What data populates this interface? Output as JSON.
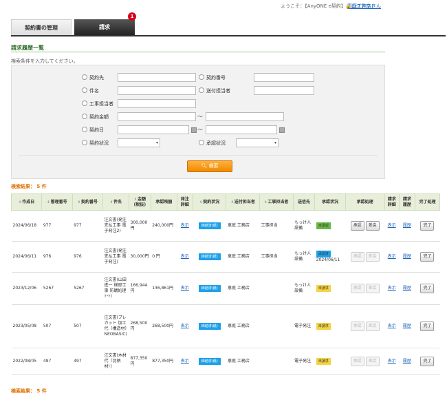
{
  "header": {
    "welcome": "ようこそ：【AnyONE e契約】",
    "user": "恵庭工務店さん",
    "logout": "ログアウト"
  },
  "tabs": [
    {
      "label": "契約書の管理"
    },
    {
      "label": "請求",
      "badge": "1"
    }
  ],
  "section_title": "請求履歴一覧",
  "hint": "検索条件を入力してください。",
  "search": {
    "contractor": "契約先",
    "contract_no": "契約番号",
    "subject": "件名",
    "sender": "送付担当者",
    "construction_person": "工事担当者",
    "amount": "契約金額",
    "date": "契約日",
    "contract_status": "契約状況",
    "approval_status": "承認状況",
    "button": "検索",
    "tilde": "～"
  },
  "result_label": "検索結果： 5 件",
  "columns": [
    "作成日",
    "管理番号",
    "契約番号",
    "件名",
    "金額\n(税抜)",
    "承認残額",
    "発注\n詳細",
    "契約状況",
    "送付担当者",
    "工事担当者",
    "送信先",
    "承認状況",
    "承認処理",
    "請求\n詳細",
    "請求\n履歴",
    "完了処理"
  ],
  "rows": [
    {
      "date": "2024/06/18",
      "mgmt": "977",
      "no": "977",
      "subject": "注文書(発注支払工事 電子発注2)",
      "amount": "300,000円",
      "remaining": "240,000円",
      "detail": "表示",
      "status": "締結済(紙)",
      "sender": "恵庭 工務店",
      "builder": "工事担当",
      "dest": "もっけ人設備",
      "approval": "未承認",
      "approval_date": "",
      "approve": "承認",
      "reject": "差戻",
      "enabled": true,
      "bill_detail": "表示",
      "bill_history": "履歴",
      "complete": "完了"
    },
    {
      "date": "2024/06/11",
      "mgmt": "976",
      "no": "976",
      "subject": "注文書(発注支払工事 電子発注)",
      "amount": "30,000円",
      "remaining": "0 円",
      "detail": "表示",
      "status": "締結済(紙)",
      "sender": "恵庭 工務店",
      "builder": "工事担当",
      "dest": "もっけ人設備",
      "approval": "承認済",
      "approval_date": "2024/06/11",
      "approve": "承認",
      "reject": "差戻",
      "enabled": false,
      "bill_detail": "表示",
      "bill_history": "履歴",
      "complete": "完了"
    },
    {
      "date": "2023/12/06",
      "mgmt": "5267",
      "no": "5267",
      "subject": "注文書(山田 進一 様邸工事 防蟻処理 ｿｰﾄ)",
      "amount": "166,944円",
      "remaining": "136,861円",
      "detail": "表示",
      "status": "締結済(紙)",
      "sender": "恵庭 工務店",
      "builder": "",
      "dest": "もっけ人設備",
      "approval": "未請求",
      "approval_date": "",
      "approve": "承認",
      "reject": "差戻",
      "enabled": false,
      "bill_detail": "表示",
      "bill_history": "履歴",
      "complete": "完了"
    },
    {
      "date": "2023/05/08",
      "mgmt": "507",
      "no": "507",
      "subject": "注文書(プレカット 加工代（構造材）NEOBASIC)",
      "amount": "268,500円",
      "remaining": "268,500円",
      "detail": "表示",
      "status": "締結済(紙)",
      "sender": "恵庭 工務店",
      "builder": "",
      "dest": "電子発注",
      "approval": "未請求",
      "approval_date": "",
      "approve": "承認",
      "reject": "差戻",
      "enabled": false,
      "bill_detail": "表示",
      "bill_history": "履歴",
      "complete": "完了"
    },
    {
      "date": "2022/08/05",
      "mgmt": "497",
      "no": "497",
      "subject": "注文書(木材代（羽柄材）)",
      "amount": "877,350円",
      "remaining": "877,350円",
      "detail": "表示",
      "status": "締結済(紙)",
      "sender": "恵庭 工務店",
      "builder": "",
      "dest": "電子発注",
      "approval": "未請求",
      "approval_date": "",
      "approve": "承認",
      "reject": "差戻",
      "enabled": false,
      "bill_detail": "表示",
      "bill_history": "履歴",
      "complete": "完了"
    }
  ],
  "colors": {
    "accent": "#f08a00",
    "header_green": "#e7efda",
    "status_blue": "#1ea0e8",
    "approved_green": "#66b845",
    "unbilled_yellow": "#f5d343"
  }
}
